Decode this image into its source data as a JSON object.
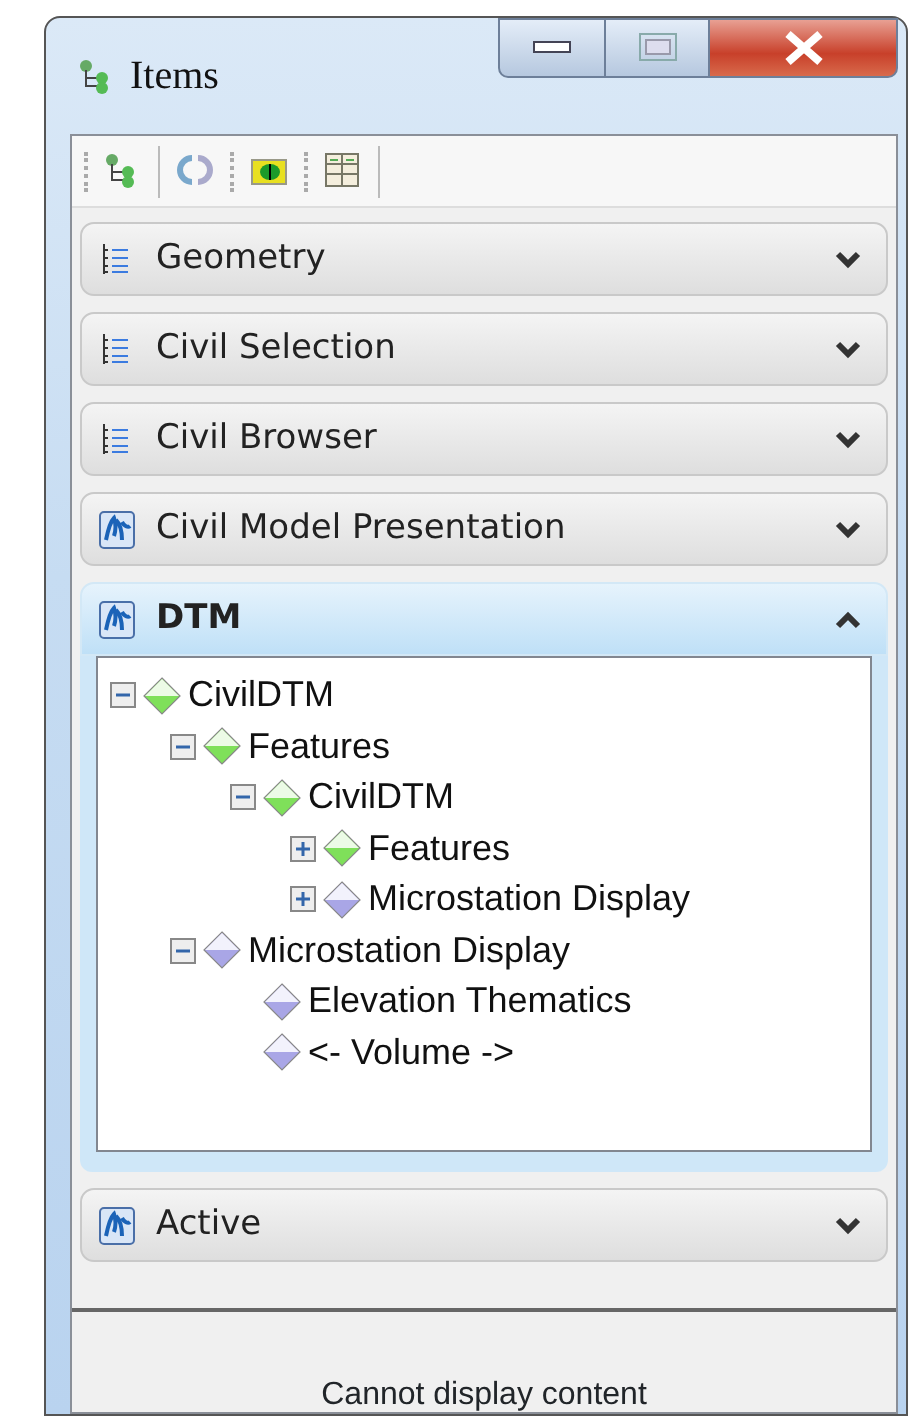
{
  "window": {
    "title": "Items"
  },
  "toolbar": [
    {
      "kind": "tree"
    },
    {
      "kind": "refresh"
    },
    {
      "kind": "folder"
    },
    {
      "kind": "grid"
    }
  ],
  "sections": [
    {
      "label": "Geometry",
      "kind": "tree",
      "expanded": false
    },
    {
      "label": "Civil Selection",
      "kind": "tree",
      "expanded": false
    },
    {
      "label": "Civil Browser",
      "kind": "tree",
      "expanded": false
    },
    {
      "label": "Civil Model Presentation",
      "kind": "model",
      "expanded": false
    },
    {
      "label": "DTM",
      "kind": "model",
      "expanded": true,
      "tree": [
        {
          "label": "CivilDTM",
          "color": "#7fe05a",
          "expanded": true,
          "children": [
            {
              "label": "Features",
              "color": "#7fe05a",
              "expanded": true,
              "children": [
                {
                  "label": "CivilDTM",
                  "color": "#7fe05a",
                  "expanded": true,
                  "children": [
                    {
                      "label": "Features",
                      "color": "#7fe05a",
                      "expanded": false
                    },
                    {
                      "label": "Microstation Display",
                      "color": "#a9a6e6",
                      "expanded": false
                    }
                  ]
                }
              ]
            },
            {
              "label": "Microstation Display",
              "color": "#a9a6e6",
              "expanded": true,
              "children": [
                {
                  "label": "Elevation Thematics",
                  "color": "#a9a6e6"
                },
                {
                  "label": "<- Volume ->",
                  "color": "#a9a6e6"
                }
              ]
            }
          ]
        }
      ]
    },
    {
      "label": "Active",
      "kind": "model",
      "expanded": false
    }
  ],
  "status": {
    "message": "Cannot display content"
  }
}
